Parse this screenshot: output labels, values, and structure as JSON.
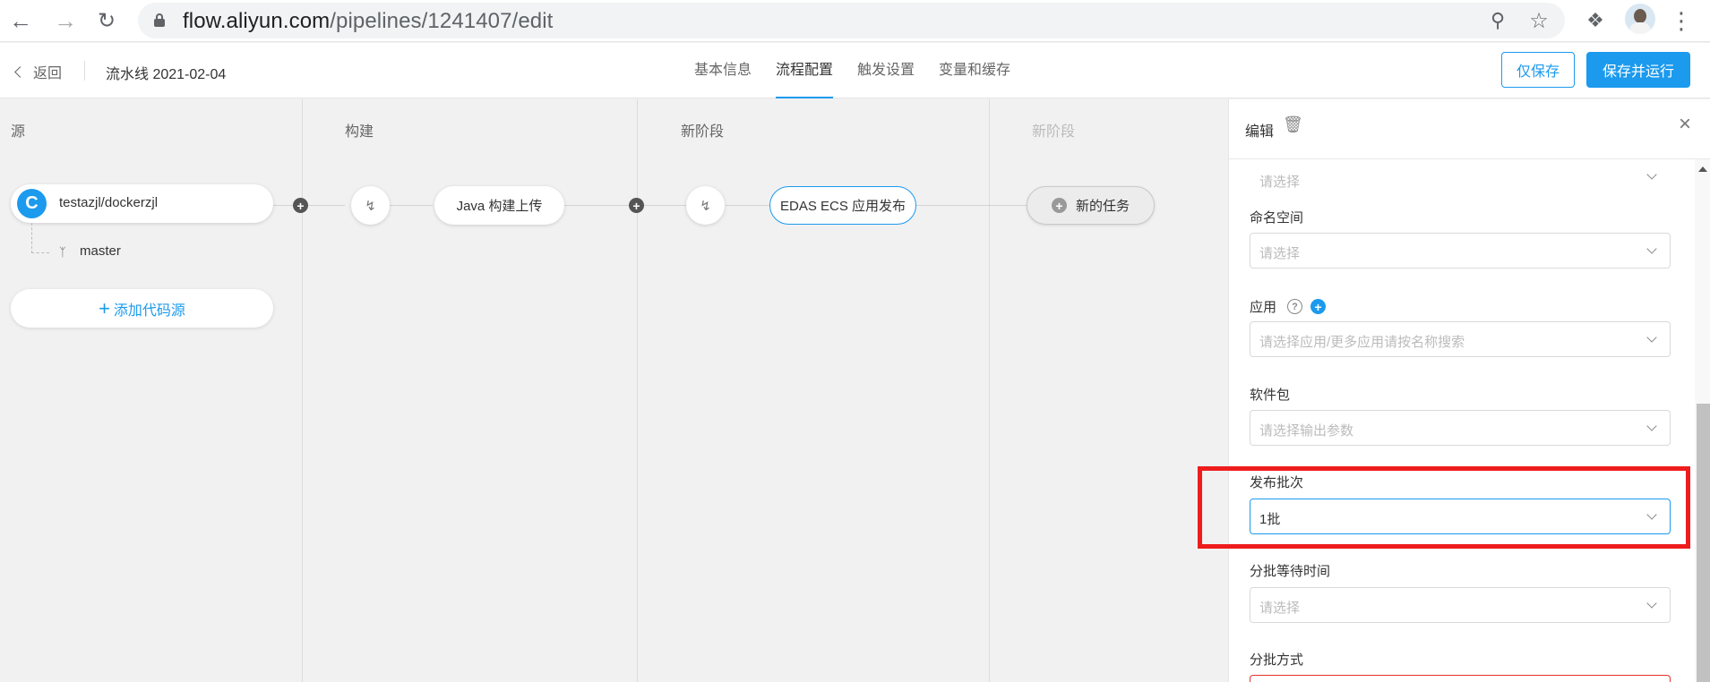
{
  "browser": {
    "url_domain": "flow.aliyun.com",
    "url_path": "/pipelines/1241407/edit"
  },
  "header": {
    "back_label": "返回",
    "pipeline_title": "流水线 2021-02-04",
    "tabs": [
      {
        "label": "基本信息",
        "active": false
      },
      {
        "label": "流程配置",
        "active": true
      },
      {
        "label": "触发设置",
        "active": false
      },
      {
        "label": "变量和缓存",
        "active": false
      }
    ],
    "save_label": "仅保存",
    "save_run_label": "保存并运行"
  },
  "canvas": {
    "stages": [
      "源",
      "构建",
      "新阶段",
      "新阶段"
    ],
    "source": {
      "logo_letter": "C",
      "repo": "testazjl/dockerzjl",
      "branch": "master"
    },
    "add_source_label": "添加代码源",
    "tasks": {
      "build": "Java 构建上传",
      "deploy": "EDAS ECS 应用发布",
      "new_task": "新的任务"
    }
  },
  "panel": {
    "title": "编辑",
    "top_select_placeholder": "请选择",
    "fields": [
      {
        "label": "命名空间",
        "value": "请选择",
        "filled": false
      },
      {
        "label": "应用",
        "value": "请选择应用/更多应用请按名称搜索",
        "filled": false
      },
      {
        "label": "软件包",
        "value": "请选择输出参数",
        "filled": false
      },
      {
        "label": "发布批次",
        "value": "1批",
        "filled": true
      },
      {
        "label": "分批等待时间",
        "value": "请选择",
        "filled": false
      },
      {
        "label": "分批方式",
        "value": "",
        "filled": false
      }
    ]
  },
  "colors": {
    "accent": "#1b9aee",
    "highlight": "#ee1c1c",
    "error": "#e6332a"
  }
}
